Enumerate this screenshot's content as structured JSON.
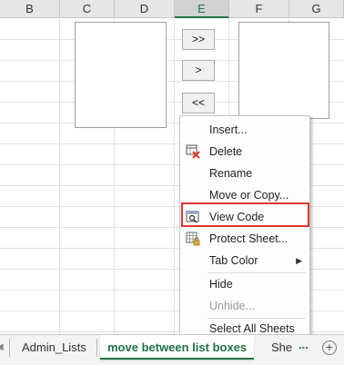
{
  "columns": [
    "B",
    "C",
    "D",
    "E",
    "F",
    "G"
  ],
  "form_buttons": {
    "move_all": ">>",
    "move_one": ">",
    "move_back_all": "<<"
  },
  "context_menu": {
    "items": [
      {
        "label": "Insert...",
        "icon": "",
        "disabled": false
      },
      {
        "label": "Delete",
        "icon": "delete-sheet-icon",
        "disabled": false
      },
      {
        "label": "Rename",
        "icon": "",
        "disabled": false
      },
      {
        "label": "Move or Copy...",
        "icon": "",
        "disabled": false
      },
      {
        "label": "View Code",
        "icon": "view-code-icon",
        "disabled": false,
        "highlighted": true
      },
      {
        "label": "Protect Sheet...",
        "icon": "protect-sheet-icon",
        "disabled": false
      },
      {
        "label": "Tab Color",
        "icon": "",
        "disabled": false,
        "submenu": true
      },
      {
        "label": "Hide",
        "icon": "",
        "disabled": false
      },
      {
        "label": "Unhide...",
        "icon": "",
        "disabled": true
      },
      {
        "label": "Select All Sheets",
        "icon": "",
        "disabled": false
      }
    ],
    "highlight_color": "#e2342f"
  },
  "tabs": {
    "nav_prev": "◀",
    "sheets": [
      "Admin_Lists",
      "move between list boxes",
      "She"
    ],
    "active": "move between list boxes",
    "more": "...",
    "add": "+"
  },
  "colors": {
    "excel_green": "#217346",
    "header_bg": "#e6e6e6"
  }
}
